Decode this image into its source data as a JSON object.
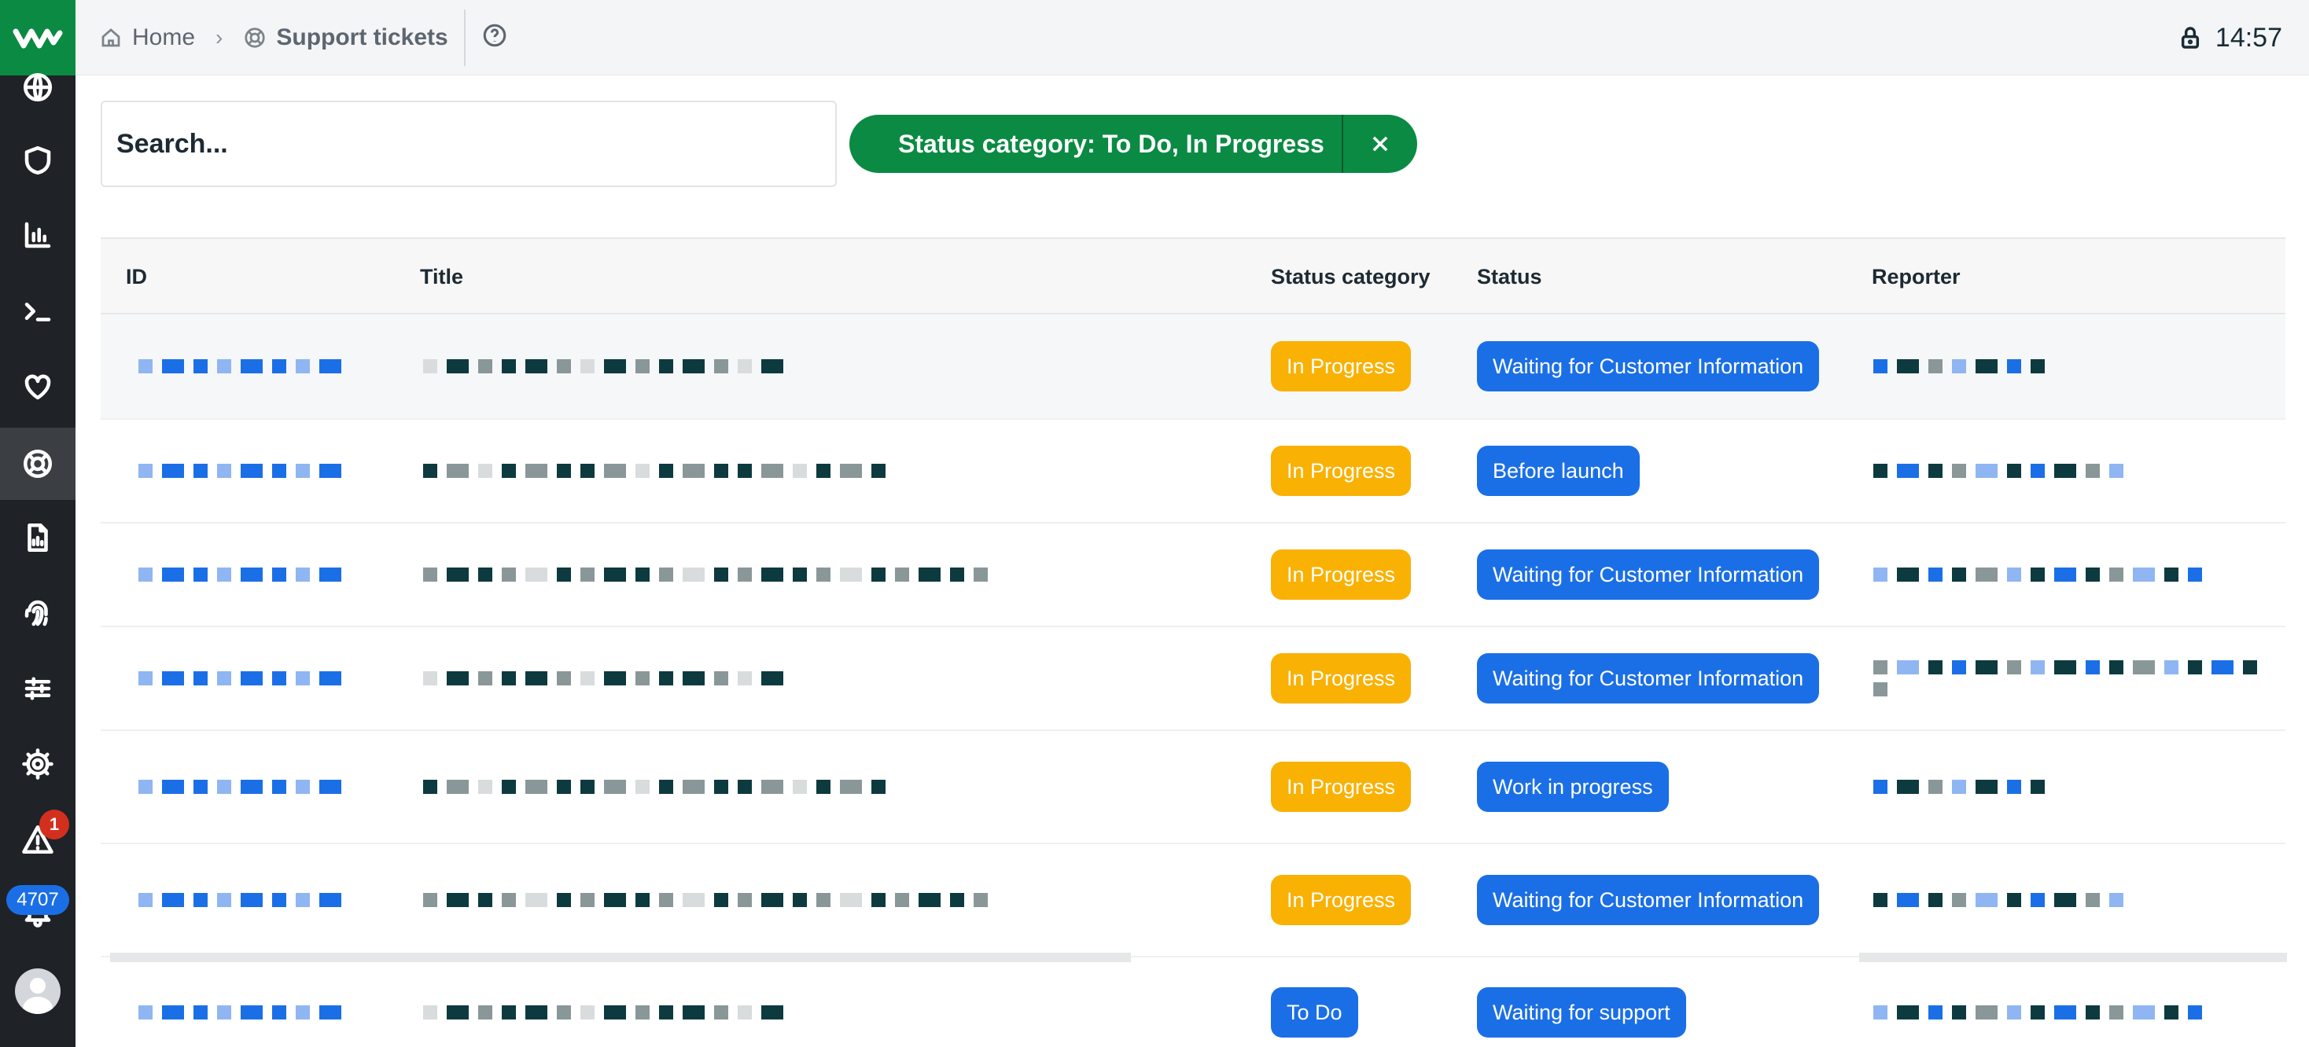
{
  "topbar": {
    "breadcrumb_home": "Home",
    "breadcrumb_current": "Support tickets",
    "time": "14:57"
  },
  "sidebar": {
    "items": [
      {
        "icon": "globe-icon"
      },
      {
        "icon": "shield-icon"
      },
      {
        "icon": "bar-chart-icon"
      },
      {
        "icon": "terminal-icon"
      },
      {
        "icon": "heart-icon"
      },
      {
        "icon": "lifebuoy-icon",
        "active": true
      },
      {
        "icon": "document-chart-icon"
      },
      {
        "icon": "fingerprint-icon"
      },
      {
        "icon": "sliders-icon"
      },
      {
        "icon": "gear-icon"
      },
      {
        "icon": "warning-icon",
        "badge": "1"
      },
      {
        "icon": "bell-icon",
        "badge": "4707"
      }
    ]
  },
  "search": {
    "placeholder": "Search..."
  },
  "filter": {
    "label": "Status category: To Do, In Progress"
  },
  "table": {
    "columns": [
      "ID",
      "Title",
      "Status category",
      "Status",
      "Reporter"
    ],
    "rows": [
      {
        "status_category": "In Progress",
        "status": "Waiting for Customer Information"
      },
      {
        "status_category": "In Progress",
        "status": "Before launch"
      },
      {
        "status_category": "In Progress",
        "status": "Waiting for Customer Information"
      },
      {
        "status_category": "In Progress",
        "status": "Waiting for Customer Information"
      },
      {
        "status_category": "In Progress",
        "status": "Work in progress"
      },
      {
        "status_category": "In Progress",
        "status": "Waiting for Customer Information"
      },
      {
        "status_category": "To Do",
        "status": "Waiting for support"
      }
    ]
  },
  "colors": {
    "brand_green": "#0b8a43",
    "sidebar_bg": "#1f2226",
    "in_progress": "#f9b104",
    "blue": "#1b6fe6",
    "alert_red": "#d32f1f"
  }
}
